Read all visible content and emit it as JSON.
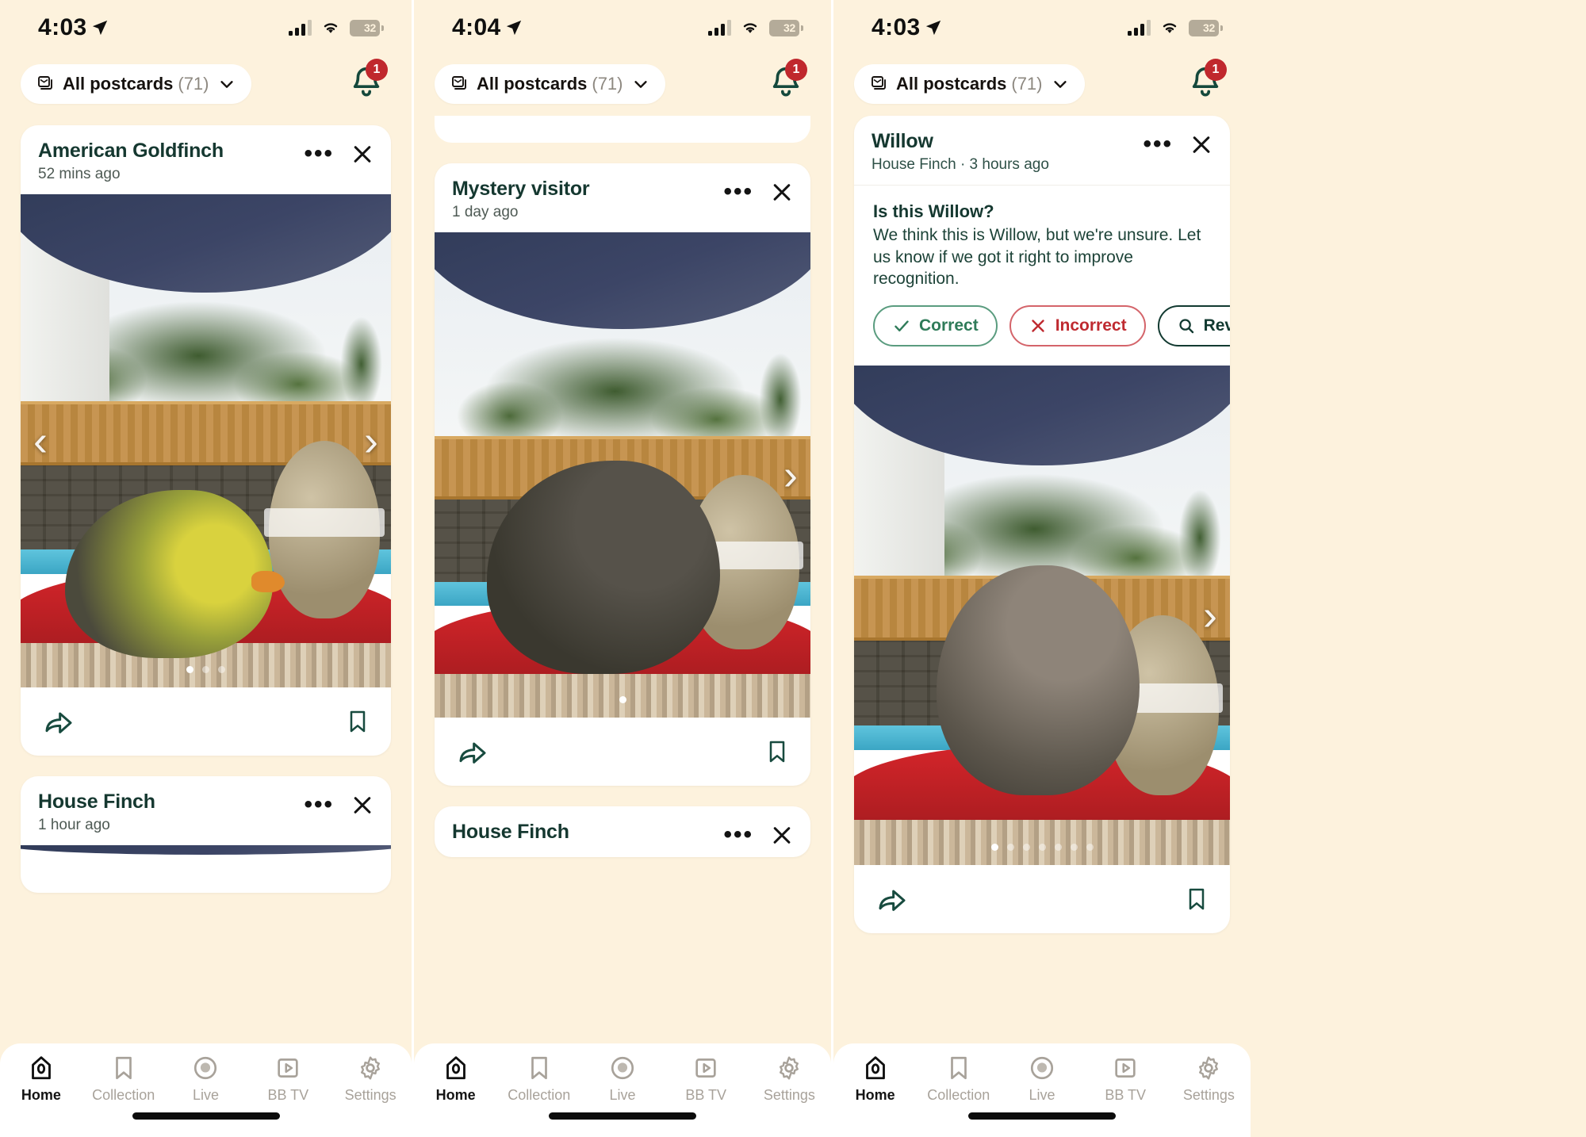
{
  "app": {
    "background": "#fdf2dd",
    "accent_green": "#153830",
    "badge_red": "#c0282d"
  },
  "panels": [
    {
      "status": {
        "time": "4:03",
        "location_icon": "location-arrow-icon",
        "signal_icon": "cellular-signal-icon",
        "wifi_icon": "wifi-icon",
        "battery": "32"
      },
      "topbar": {
        "filter_label": "All postcards",
        "filter_count": "(71)",
        "filter_icon": "postcards-icon",
        "chevron": "chevron-down-icon",
        "bell_icon": "bell-icon",
        "bell_badge": "1"
      },
      "cards": [
        {
          "title": "American Goldfinch",
          "subtitle": "52 mins ago",
          "menu": "•••",
          "close": "close-icon",
          "photo": {
            "scene": "goldfinch",
            "dots": 3,
            "active_dot": 0,
            "left_arrow": "‹",
            "right_arrow": "›"
          },
          "share_icon": "share-icon",
          "bookmark_icon": "bookmark-icon"
        },
        {
          "title": "House Finch",
          "subtitle": "1 hour ago",
          "menu": "•••",
          "close": "close-icon"
        }
      ],
      "tabs": [
        {
          "label": "Home",
          "icon": "home-icon",
          "active": true
        },
        {
          "label": "Collection",
          "icon": "bookmark-icon",
          "active": false
        },
        {
          "label": "Live",
          "icon": "live-icon",
          "active": false
        },
        {
          "label": "BB TV",
          "icon": "play-icon",
          "active": false
        },
        {
          "label": "Settings",
          "icon": "gear-icon",
          "active": false
        }
      ]
    },
    {
      "status": {
        "time": "4:04",
        "location_icon": "location-arrow-icon",
        "signal_icon": "cellular-signal-icon",
        "wifi_icon": "wifi-icon",
        "battery": "32"
      },
      "topbar": {
        "filter_label": "All postcards",
        "filter_count": "(71)",
        "filter_icon": "postcards-icon",
        "chevron": "chevron-down-icon",
        "bell_icon": "bell-icon",
        "bell_badge": "1"
      },
      "cards": [
        {
          "title": "Mystery visitor",
          "subtitle": "1 day ago",
          "menu": "•••",
          "close": "close-icon",
          "photo": {
            "scene": "mystery",
            "dots": 1,
            "active_dot": 0,
            "right_arrow": "›"
          },
          "share_icon": "share-icon",
          "bookmark_icon": "bookmark-icon"
        },
        {
          "title": "House Finch",
          "subtitle": "",
          "menu": "•••",
          "close": "close-icon"
        }
      ],
      "tabs": [
        {
          "label": "Home",
          "icon": "home-icon",
          "active": true
        },
        {
          "label": "Collection",
          "icon": "bookmark-icon",
          "active": false
        },
        {
          "label": "Live",
          "icon": "live-icon",
          "active": false
        },
        {
          "label": "BB TV",
          "icon": "play-icon",
          "active": false
        },
        {
          "label": "Settings",
          "icon": "gear-icon",
          "active": false
        }
      ]
    },
    {
      "status": {
        "time": "4:03",
        "location_icon": "location-arrow-icon",
        "signal_icon": "cellular-signal-icon",
        "wifi_icon": "wifi-icon",
        "battery": "32"
      },
      "topbar": {
        "filter_label": "All postcards",
        "filter_count": "(71)",
        "filter_icon": "postcards-icon",
        "chevron": "chevron-down-icon",
        "bell_icon": "bell-icon",
        "bell_badge": "1"
      },
      "cards": [
        {
          "title": "Willow",
          "subtitle": "House Finch · 3 hours ago",
          "menu": "•••",
          "close": "close-icon",
          "confirm": {
            "heading": "Is this Willow?",
            "body": "We think this is Willow, but we're unsure. Let us know if we got it right to improve recognition.",
            "buttons": [
              {
                "label": "Correct",
                "icon": "check-icon",
                "style": "correct"
              },
              {
                "label": "Incorrect",
                "icon": "x-icon",
                "style": "incorrect"
              },
              {
                "label": "Review",
                "icon": "search-icon",
                "style": "review"
              }
            ]
          },
          "photo": {
            "scene": "willow",
            "dots": 7,
            "active_dot": 0,
            "right_arrow": "›"
          },
          "share_icon": "share-icon",
          "bookmark_icon": "bookmark-icon"
        }
      ],
      "tabs": [
        {
          "label": "Home",
          "icon": "home-icon",
          "active": true
        },
        {
          "label": "Collection",
          "icon": "bookmark-icon",
          "active": false
        },
        {
          "label": "Live",
          "icon": "live-icon",
          "active": false
        },
        {
          "label": "BB TV",
          "icon": "play-icon",
          "active": false
        },
        {
          "label": "Settings",
          "icon": "gear-icon",
          "active": false
        }
      ]
    }
  ]
}
